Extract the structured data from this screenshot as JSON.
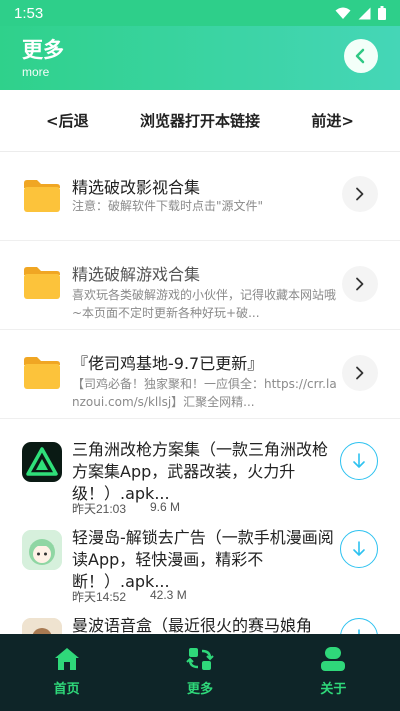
{
  "status": {
    "time": "1:53"
  },
  "header": {
    "title": "更多",
    "subtitle": "more"
  },
  "toolbar": {
    "back": "<后退",
    "open_browser": "浏览器打开本链接",
    "forward": "前进>"
  },
  "links": [
    {
      "title": "精选破改影视合集",
      "desc": "注意：破解软件下载时点击\"源文件\""
    },
    {
      "title": "精选破解游戏合集",
      "desc": "喜欢玩各类破解游戏的小伙伴，记得收藏本网站哦~本页面不定时更新各种好玩+破..."
    },
    {
      "title": "『佬司鸡基地-9.7已更新』",
      "desc": "【司鸡必备！独家聚和！一应俱全：https://crr.lanzoui.com/s/kllsj】汇聚全网精..."
    }
  ],
  "files": [
    {
      "name": "三角洲改枪方案集（一款三角洲改枪方案集App，武器改装，火力升级！）.apk...",
      "time": "昨天21:03",
      "size": "9.6 M"
    },
    {
      "name": "轻漫岛-解锁去广告（一款手机漫画阅读App，轻快漫画，精彩不断！）.apk...",
      "time": "昨天14:52",
      "size": "42.3 M"
    },
    {
      "name": "曼波语音盒（最近很火的赛马娘角",
      "time": "",
      "size": ""
    }
  ],
  "nav": {
    "home": "首页",
    "more": "更多",
    "about": "关于"
  },
  "colors": {
    "accent": "#2fd18b",
    "nav_bg": "#0e2528",
    "nav_text": "#2fd87a",
    "download": "#2ec2f0",
    "folder": "#fcc33b"
  }
}
